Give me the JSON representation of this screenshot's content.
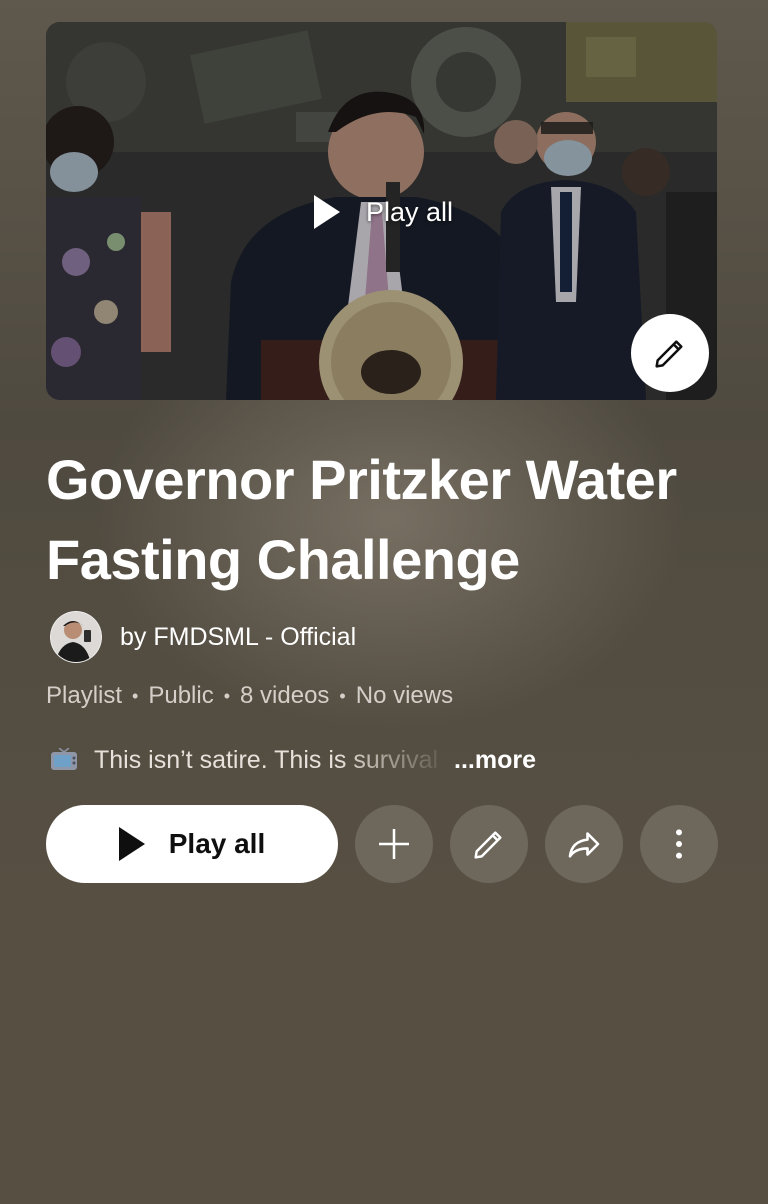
{
  "thumbnail": {
    "play_label": "Play all",
    "edit_icon": "pencil-icon"
  },
  "playlist": {
    "title": "Governor Pritzker Water Fasting Challenge",
    "owner": "by FMDSML - Official",
    "type": "Playlist",
    "visibility": "Public",
    "video_count": "8 videos",
    "views": "No views",
    "description": "This isn’t satire. This is survival",
    "more_label": "...more"
  },
  "actions": {
    "play_all_label": "Play all",
    "add_icon": "plus-icon",
    "edit_icon": "pencil-icon",
    "share_icon": "share-icon",
    "more_icon": "more-vertical-icon"
  },
  "colors": {
    "background": "#574f42",
    "primary_button": "#ffffff",
    "circle_button": "rgba(255,255,255,0.14)"
  }
}
